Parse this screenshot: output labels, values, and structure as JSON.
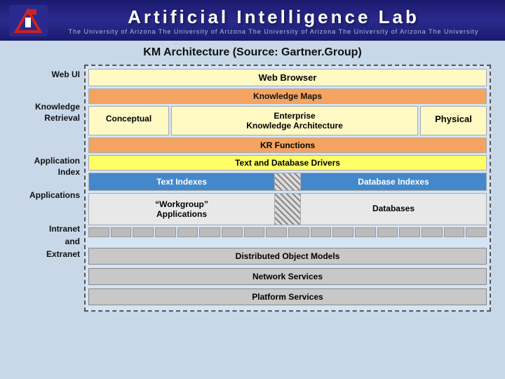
{
  "header": {
    "main_title": "Artificial  Intelligence  Lab",
    "subtitle": "The University of Arizona   The University of Arizona   The University of Arizona   The University of Arizona   The University",
    "logo_text": "AI"
  },
  "page": {
    "title": "KM Architecture (Source: Gartner.Group)"
  },
  "labels": {
    "web_ui": "Web UI",
    "knowledge_retrieval": "Knowledge\nRetrieval",
    "application_index": "Application\nIndex",
    "applications": "Applications",
    "intranet_extranet": "Intranet\nand\nExtranet"
  },
  "diagram": {
    "web_browser": "Web Browser",
    "knowledge_maps": "Knowledge Maps",
    "conceptual": "Conceptual",
    "enterprise_ka_line1": "Enterprise",
    "enterprise_ka_line2": "Knowledge Architecture",
    "physical": "Physical",
    "kr_functions": "KR Functions",
    "text_database_drivers": "Text and Database Drivers",
    "text_indexes": "Text Indexes",
    "database_indexes": "Database Indexes",
    "workgroup_apps_line1": "“Workgroup”",
    "workgroup_apps_line2": "Applications",
    "databases": "Databases",
    "distributed_object_models": "Distributed Object Models",
    "network_services": "Network Services",
    "platform_services": "Platform Services"
  }
}
